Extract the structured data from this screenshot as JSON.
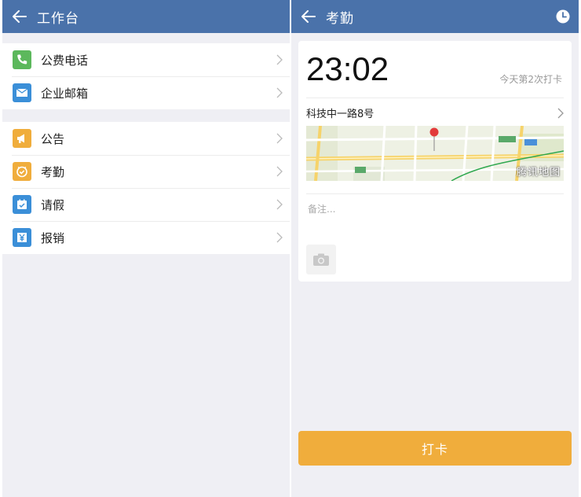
{
  "left": {
    "title": "工作台",
    "groups": [
      {
        "items": [
          {
            "label": "公费电话",
            "icon": "phone-icon",
            "color": "#5cb85c"
          },
          {
            "label": "企业邮箱",
            "icon": "mail-icon",
            "color": "#3b8fd8"
          }
        ]
      },
      {
        "items": [
          {
            "label": "公告",
            "icon": "megaphone-icon",
            "color": "#f0ad3c"
          },
          {
            "label": "考勤",
            "icon": "attendance-icon",
            "color": "#f0ad3c"
          },
          {
            "label": "请假",
            "icon": "calendar-check-icon",
            "color": "#3b8fd8"
          },
          {
            "label": "报销",
            "icon": "yen-icon",
            "color": "#3b8fd8"
          }
        ]
      }
    ]
  },
  "right": {
    "title": "考勤",
    "time": "23:02",
    "count_text": "今天第2次打卡",
    "address": "科技中一路8号",
    "map_brand": "腾讯地图",
    "remark_placeholder": "备注...",
    "punch_label": "打卡"
  },
  "colors": {
    "topbar": "#4a72aa",
    "punch": "#f0ad3c",
    "background": "#efeff4"
  }
}
